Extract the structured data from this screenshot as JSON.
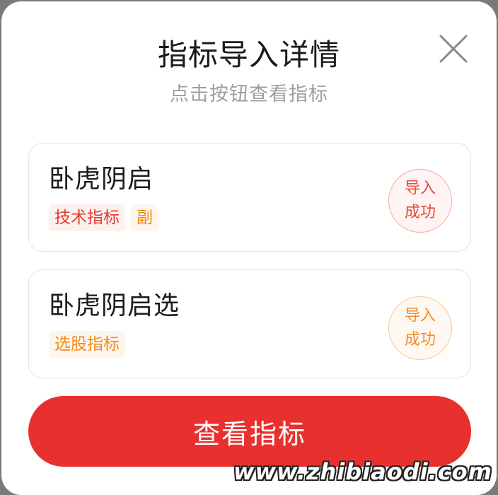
{
  "dialog": {
    "title": "指标导入详情",
    "subtitle": "点击按钮查看指标",
    "close_icon": "close-icon"
  },
  "items": [
    {
      "name": "卧虎阴启",
      "tags": [
        "技术指标",
        "副"
      ],
      "status_line1": "导入",
      "status_line2": "成功",
      "status_color": "#e54a3f"
    },
    {
      "name": "卧虎阴启选",
      "tags": [
        "选股指标"
      ],
      "status_line1": "导入",
      "status_line2": "成功",
      "status_color": "#ef8d2c"
    }
  ],
  "primary_button": {
    "label": "查看指标",
    "color": "#e8312f"
  },
  "watermark": "www.zhibiaodi.com"
}
